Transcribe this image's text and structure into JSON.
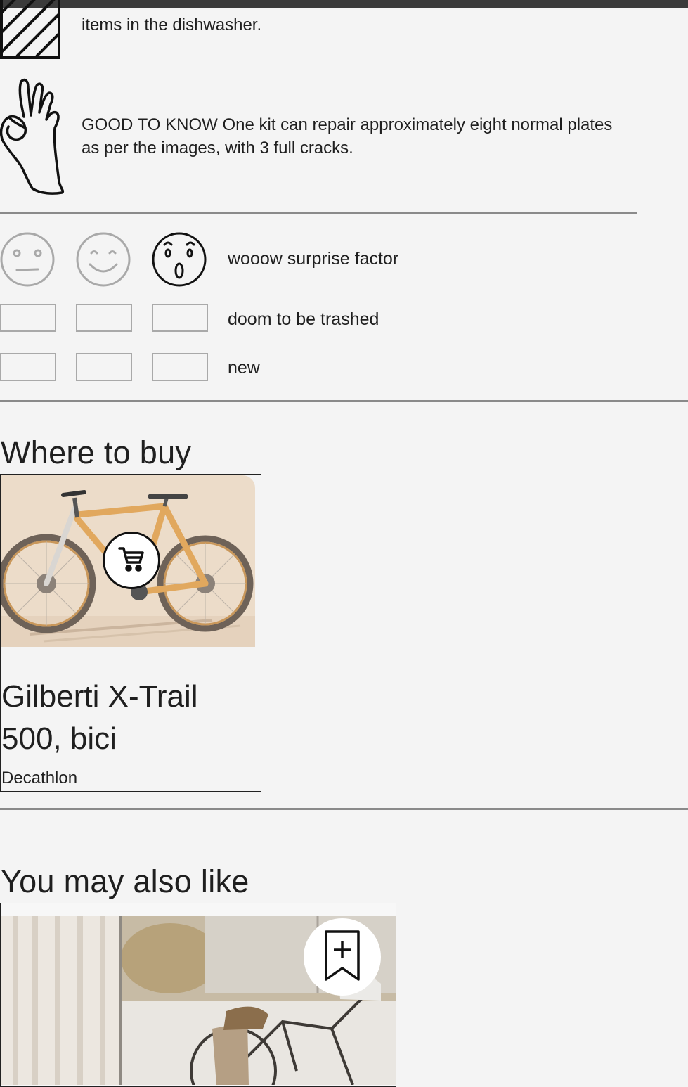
{
  "care_tips": {
    "dishwasher_text": "items in the dishwasher.",
    "good_to_know_text": "GOOD TO KNOW One kit can repair approximately eight normal plates as per the images, with 3 full cracks."
  },
  "rating": {
    "faces": [
      {
        "icon": "neutral-face-icon",
        "selected": false
      },
      {
        "icon": "smile-face-icon",
        "selected": false
      },
      {
        "icon": "surprised-face-icon",
        "selected": true
      }
    ],
    "rows": [
      {
        "label": "wooow surprise factor"
      },
      {
        "label": "doom to be trashed"
      },
      {
        "label": "new"
      }
    ]
  },
  "where_to_buy": {
    "title": "Where to buy",
    "product": {
      "name": "Gilberti X-Trail 500, bici",
      "store": "Decathlon",
      "cart_icon": "shopping-cart-icon"
    }
  },
  "you_may_also_like": {
    "title": "You may also like",
    "save_icon": "bookmark-add-icon"
  },
  "colors": {
    "background": "#f4f4f4",
    "text": "#1f1f1f",
    "divider": "#8a8a8a",
    "inactive_icon": "#a9a9a9",
    "topbar": "#3b3b3b"
  }
}
